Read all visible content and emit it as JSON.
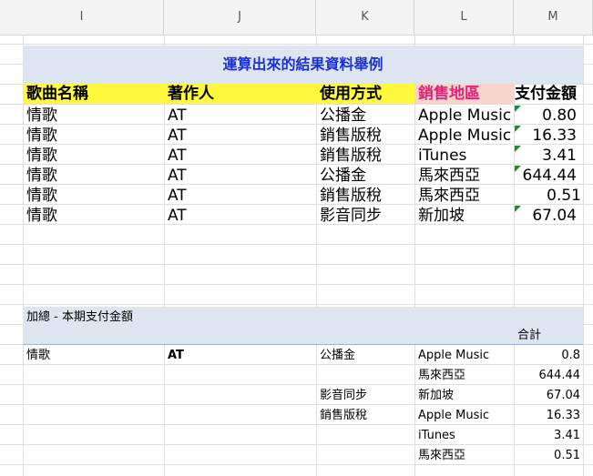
{
  "columns": [
    "I",
    "J",
    "K",
    "L",
    "M"
  ],
  "title": "運算出來的結果資料舉例",
  "headers": {
    "song": "歌曲名稱",
    "author": "著作人",
    "usage": "使用方式",
    "region": "銷售地區",
    "payment": "支付金額"
  },
  "colors": {
    "title": "#1a2fd6",
    "header_bg": "#fff93d",
    "region_header_bg": "#f9d6cc",
    "region_header_text": "#e0217c",
    "band": "#dde6f0",
    "flag": "#1e8b2c"
  },
  "rows": [
    {
      "song": "情歌",
      "author": "AT",
      "usage": "公播金",
      "region": "Apple Music",
      "amount": "0.80"
    },
    {
      "song": "情歌",
      "author": "AT",
      "usage": "銷售版稅",
      "region": "Apple Music",
      "amount": "16.33"
    },
    {
      "song": "情歌",
      "author": "AT",
      "usage": "銷售版稅",
      "region": "iTunes",
      "amount": "3.41"
    },
    {
      "song": "情歌",
      "author": "AT",
      "usage": "公播金",
      "region": "馬來西亞",
      "amount": "644.44"
    },
    {
      "song": "情歌",
      "author": "AT",
      "usage": "銷售版稅",
      "region": "馬來西亞",
      "amount": "0.51"
    },
    {
      "song": "情歌",
      "author": "AT",
      "usage": "影音同步",
      "region": "新加坡",
      "amount": "67.04"
    }
  ],
  "summary": {
    "label": "加總 - 本期支付金額",
    "total_label": "合計",
    "song": "情歌",
    "author": "AT",
    "rows": [
      {
        "usage": "公播金",
        "region": "Apple Music",
        "amount": "0.8"
      },
      {
        "usage": "",
        "region": "馬來西亞",
        "amount": "644.44"
      },
      {
        "usage": "影音同步",
        "region": "新加坡",
        "amount": "67.04"
      },
      {
        "usage": "銷售版稅",
        "region": "Apple Music",
        "amount": "16.33"
      },
      {
        "usage": "",
        "region": "iTunes",
        "amount": "3.41"
      },
      {
        "usage": "",
        "region": "馬來西亞",
        "amount": "0.51"
      }
    ]
  }
}
